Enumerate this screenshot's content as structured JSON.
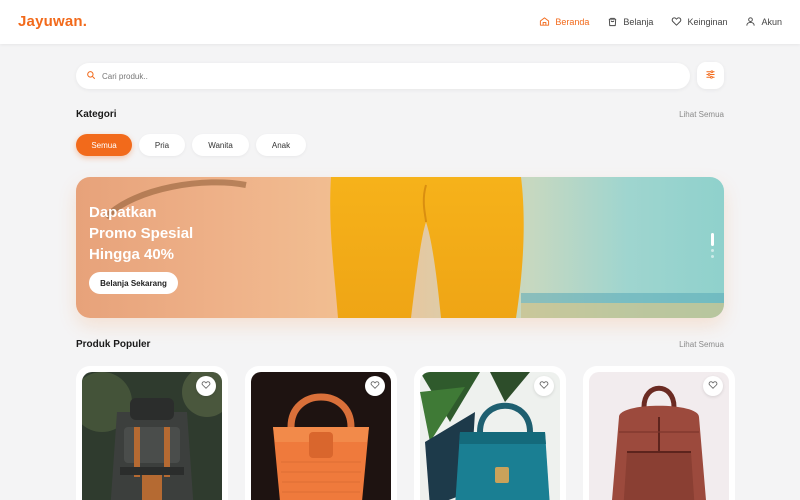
{
  "app": {
    "logo": "Jayuwan."
  },
  "nav": {
    "items": [
      {
        "label": "Beranda",
        "icon": "home-icon",
        "active": true
      },
      {
        "label": "Belanja",
        "icon": "shopping-bag-icon",
        "active": false
      },
      {
        "label": "Keinginan",
        "icon": "heart-icon",
        "active": false
      },
      {
        "label": "Akun",
        "icon": "user-icon",
        "active": false
      }
    ]
  },
  "search": {
    "placeholder": "Cari produk..",
    "value": "",
    "icon": "search-icon",
    "filter_icon": "sliders-icon"
  },
  "categories": {
    "title": "Kategori",
    "see_all": "Lihat Semua",
    "items": [
      {
        "label": "Semua",
        "active": true
      },
      {
        "label": "Pria",
        "active": false
      },
      {
        "label": "Wanita",
        "active": false
      },
      {
        "label": "Anak",
        "active": false
      }
    ]
  },
  "banner": {
    "line1": "Dapatkan",
    "line2": "Promo Spesial",
    "line3": "Hingga 40%",
    "button": "Belanja Sekarang",
    "slide_count": 3,
    "active_slide": 1
  },
  "popular": {
    "title": "Produk Populer",
    "see_all": "Lihat Semua",
    "items": [
      {
        "image": "dark green backpack with brown leather straps",
        "favorite_icon": "heart-icon"
      },
      {
        "image": "orange woven leather handbag",
        "favorite_icon": "heart-icon"
      },
      {
        "image": "teal leather handbag with plants",
        "favorite_icon": "heart-icon"
      },
      {
        "image": "brown leather backpack",
        "favorite_icon": "heart-icon"
      }
    ]
  },
  "colors": {
    "accent": "#f26a1b",
    "background": "#f4f4f5"
  }
}
